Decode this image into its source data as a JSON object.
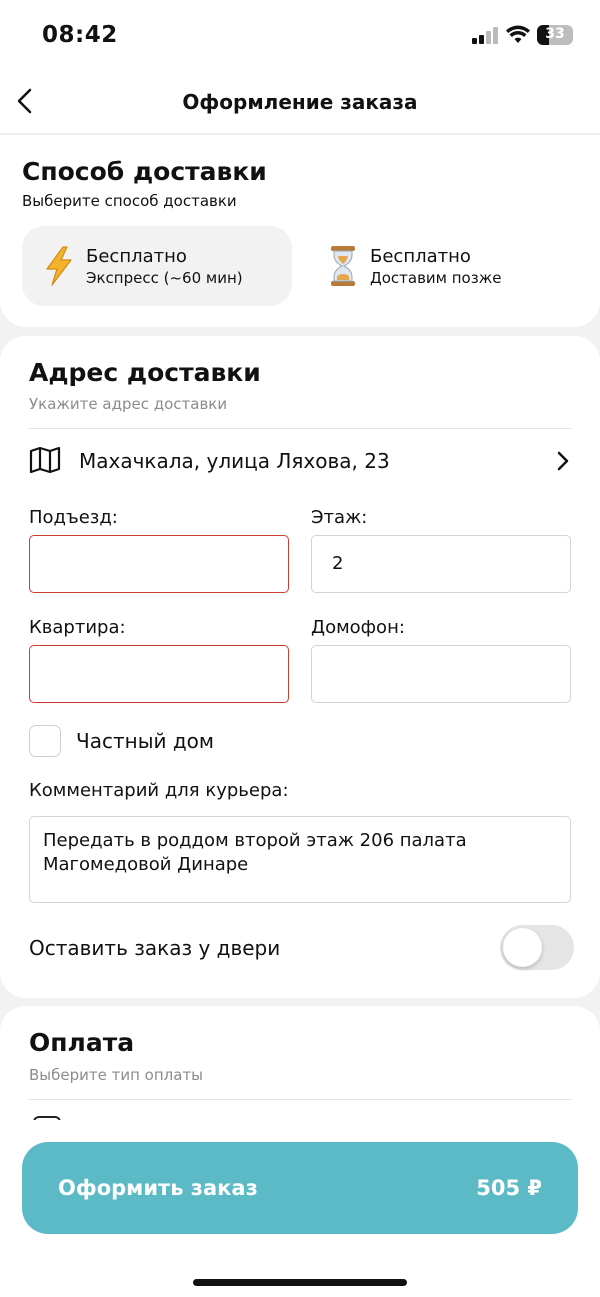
{
  "status_bar": {
    "time": "08:42",
    "battery": "33"
  },
  "header": {
    "title": "Оформление заказа"
  },
  "delivery": {
    "title": "Способ доставки",
    "subtitle": "Выберите способ доставки",
    "options": [
      {
        "price": "Бесплатно",
        "desc": "Экспресс (~60 мин)",
        "icon": "lightning-icon",
        "selected": true
      },
      {
        "price": "Бесплатно",
        "desc": "Доставим позже",
        "icon": "hourglass-icon",
        "selected": false
      }
    ]
  },
  "address": {
    "title": "Адрес доставки",
    "subtitle": "Укажите адрес доставки",
    "line": "Махачкала, улица Ляхова, 23",
    "entrance": {
      "label": "Подъезд:",
      "value": ""
    },
    "floor": {
      "label": "Этаж:",
      "value": "2"
    },
    "apartment": {
      "label": "Квартира:",
      "value": ""
    },
    "intercom": {
      "label": "Домофон:",
      "value": ""
    },
    "private_house": {
      "label": "Частный дом",
      "checked": false
    },
    "comment": {
      "label": "Комментарий для курьера:",
      "value": "Передать в роддом второй этаж 206 палата Магомедовой Динаре"
    },
    "leave_at_door": {
      "label": "Оставить заказ у двери",
      "on": false
    }
  },
  "payment": {
    "title": "Оплата",
    "subtitle": "Выберите тип оплаты"
  },
  "order_button": {
    "label": "Оформить заказ",
    "price": "505 ₽"
  },
  "colors": {
    "accent": "#5bbac5",
    "error": "#c9412e",
    "card_bg": "#ffffff",
    "page_bg": "#f2f2f2"
  }
}
